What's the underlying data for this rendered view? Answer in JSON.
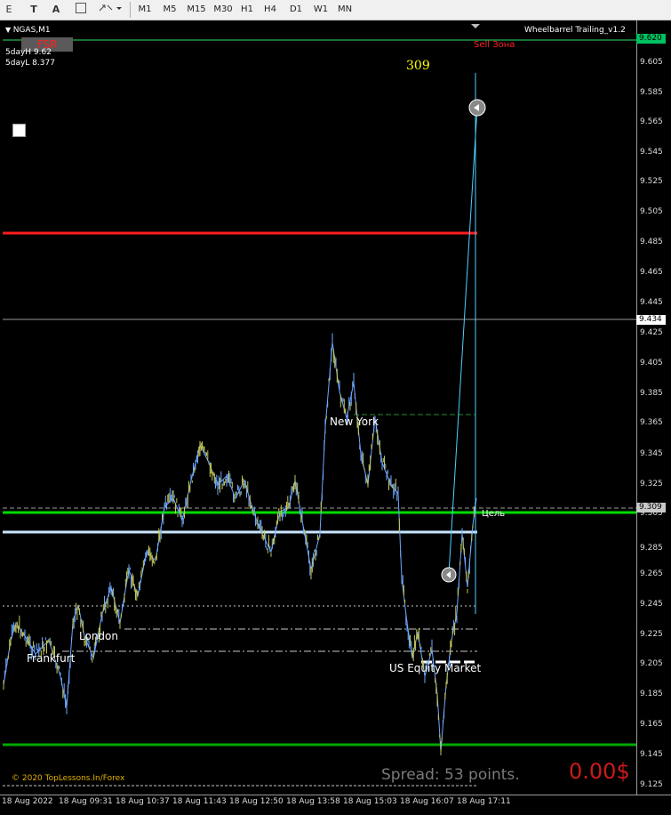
{
  "toolbar": {
    "tools": [
      "E",
      "T",
      "A"
    ],
    "timeframes": [
      "M1",
      "M5",
      "M15",
      "M30",
      "H1",
      "H4",
      "D1",
      "W1",
      "MN"
    ]
  },
  "chart": {
    "symbol_label": "NGAS,M1",
    "indicator_label": "Wheelbarrel Trailing_v1.2",
    "fsr_label": "FSR",
    "sell_zone_label": "Sell Зона",
    "range_count": "309",
    "five_day_high": "5dayH 9.62",
    "five_day_low": "5dayL 8.377",
    "target_label": "Цель",
    "sessions": [
      "Frankfurt",
      "London",
      "New York",
      "US Equity Market"
    ],
    "copyright": "© 2020 TopLessons.In/Forex",
    "spread": "Spread: 53 points.",
    "profit": "0.00$",
    "price_axis": [
      "9.620",
      "9.605",
      "9.585",
      "9.565",
      "9.545",
      "9.525",
      "9.505",
      "9.485",
      "9.465",
      "9.445",
      "9.425",
      "9.405",
      "9.385",
      "9.365",
      "9.345",
      "9.325",
      "9.305",
      "9.285",
      "9.265",
      "9.245",
      "9.225",
      "9.205",
      "9.185",
      "9.165",
      "9.145",
      "9.125"
    ],
    "price_boxes": {
      "top": "9.620",
      "mid": "9.434",
      "current": "9.309"
    },
    "time_axis": [
      "18 Aug 2022",
      "18 Aug 09:31",
      "18 Aug 10:37",
      "18 Aug 11:43",
      "18 Aug 12:50",
      "18 Aug 13:58",
      "18 Aug 15:03",
      "18 Aug 16:07",
      "18 Aug 17:11"
    ],
    "colors": {
      "bull": "#6fa8ff",
      "bear": "#c8c850",
      "resistance": "#ff1c1c",
      "support": "#00cc00",
      "target_line": "#c8e6ff",
      "projection": "#4fd0ff"
    }
  }
}
